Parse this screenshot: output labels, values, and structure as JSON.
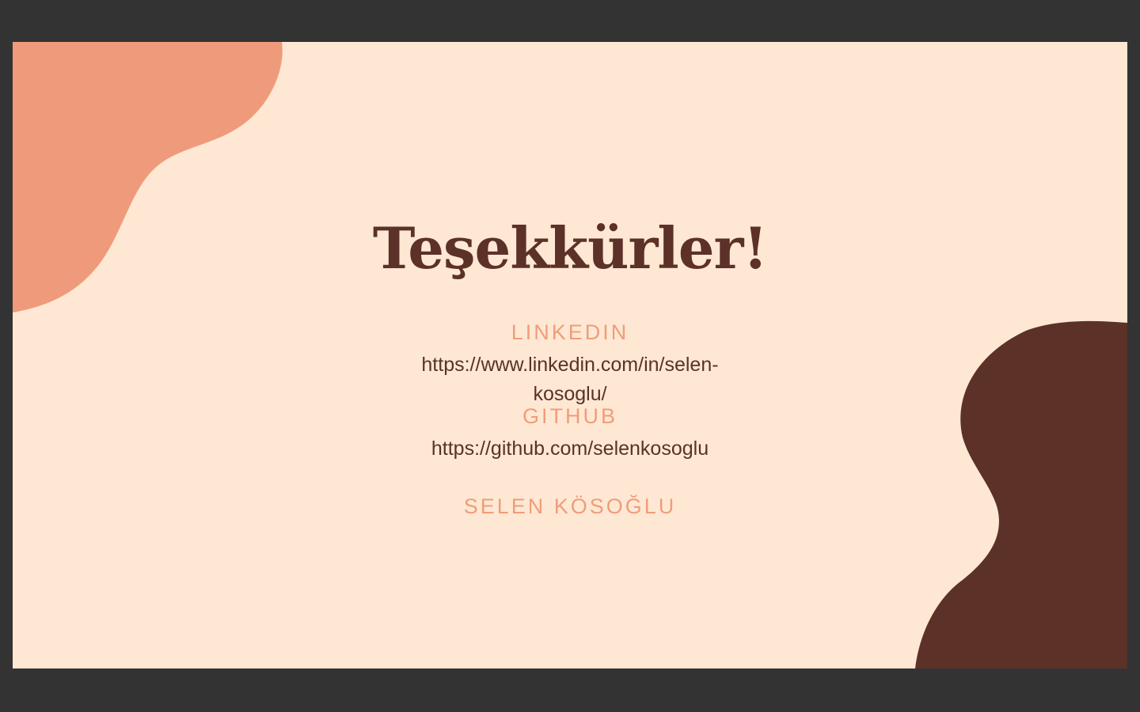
{
  "slide": {
    "title": "Teşekkürler!",
    "linkedin_label": "LINKEDIN",
    "linkedin_url_line1": "https://www.linkedin.com/in/selen-",
    "linkedin_url_line2": "kosoglu/",
    "github_label": "GITHUB",
    "github_url": "https://github.com/selenkosoglu",
    "author": "SELEN KÖSOĞLU"
  },
  "colors": {
    "background": "#fee8d4",
    "accent_peach": "#ef9b7b",
    "accent_brown": "#5c3128",
    "viewer_frame": "#333333"
  }
}
